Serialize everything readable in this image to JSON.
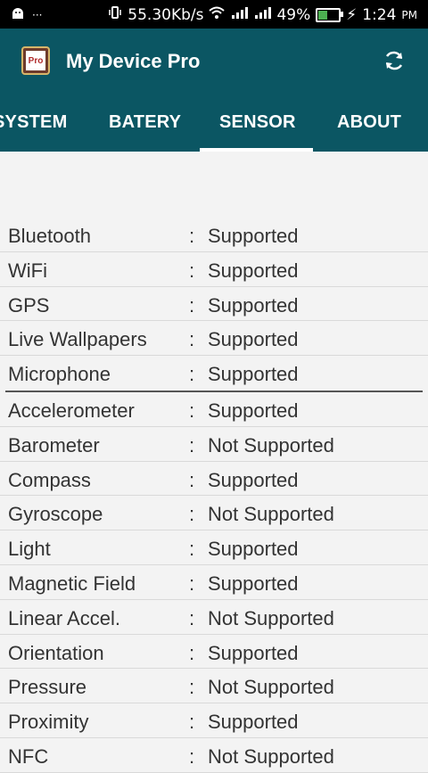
{
  "status_bar": {
    "left_icons": [
      "android-icon",
      "more-icon"
    ],
    "dots": "···",
    "speed": "55.30Kb/s",
    "battery_pct": "49%",
    "time": "1:24",
    "ampm": "PM",
    "battery_fill": 49
  },
  "app": {
    "logo_text": "Pro",
    "title": "My Device Pro"
  },
  "tabs": [
    {
      "label": "SYSTEM",
      "selected": false
    },
    {
      "label": "BATERY",
      "selected": false
    },
    {
      "label": "SENSOR",
      "selected": true
    },
    {
      "label": "ABOUT",
      "selected": false
    }
  ],
  "sensors": [
    {
      "name": "Bluetooth",
      "value": "Supported"
    },
    {
      "name": "WiFi",
      "value": "Supported"
    },
    {
      "name": "GPS",
      "value": "Supported"
    },
    {
      "name": "Live Wallpapers",
      "value": "Supported"
    },
    {
      "name": "Microphone",
      "value": "Supported"
    },
    {
      "name": "Accelerometer",
      "value": "Supported"
    },
    {
      "name": "Barometer",
      "value": "Not Supported"
    },
    {
      "name": "Compass",
      "value": "Supported"
    },
    {
      "name": "Gyroscope",
      "value": "Not Supported"
    },
    {
      "name": "Light",
      "value": "Supported"
    },
    {
      "name": "Magnetic Field",
      "value": "Supported"
    },
    {
      "name": "Linear Accel.",
      "value": "Not Supported"
    },
    {
      "name": "Orientation",
      "value": "Supported"
    },
    {
      "name": "Pressure",
      "value": "Not Supported"
    },
    {
      "name": "Proximity",
      "value": "Supported"
    },
    {
      "name": "NFC",
      "value": "Not Supported"
    }
  ],
  "colors": {
    "app_bar": "#0b5663",
    "background": "#f3f3f3",
    "status_bar": "#000000"
  }
}
